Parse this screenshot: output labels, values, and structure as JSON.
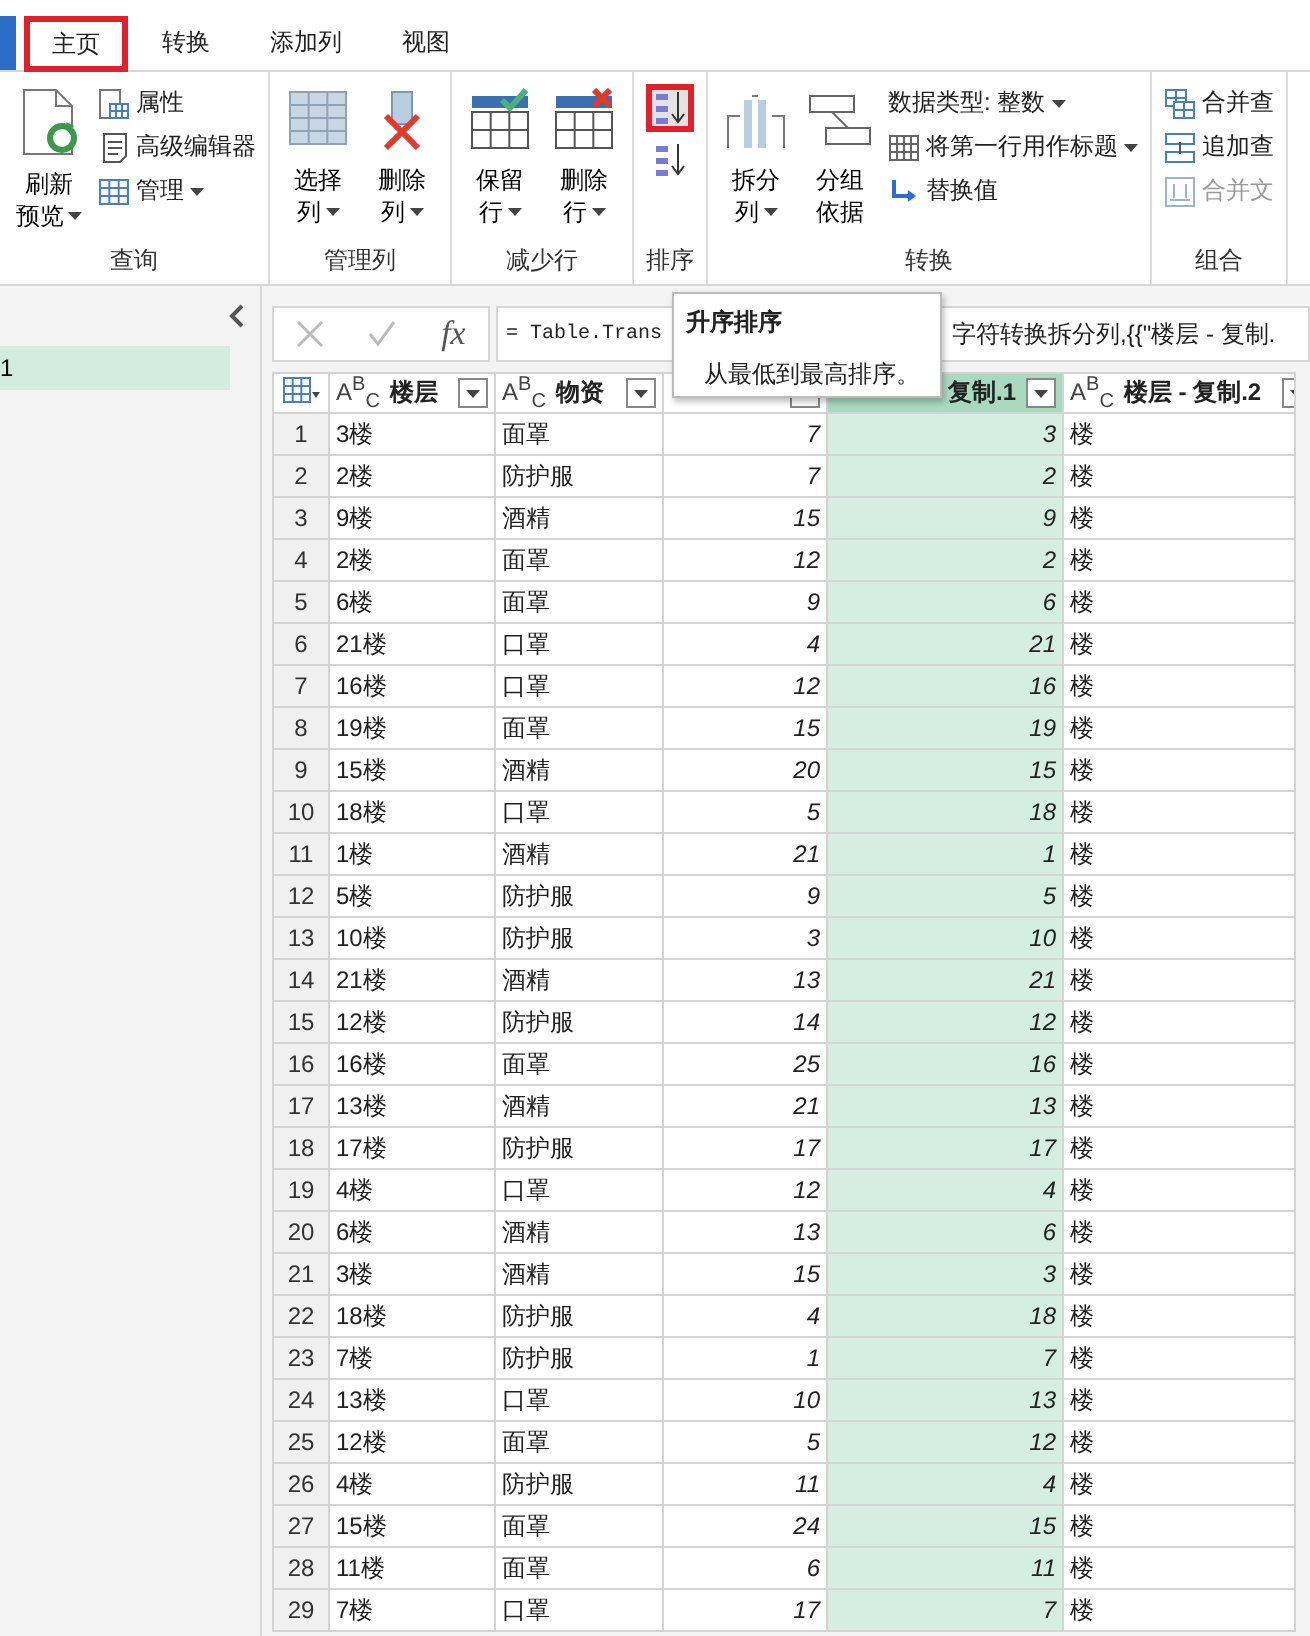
{
  "ribbon_tabs": [
    {
      "label": "主页",
      "selected": true,
      "annotated": true
    },
    {
      "label": "转换",
      "selected": false,
      "annotated": false
    },
    {
      "label": "添加列",
      "selected": false,
      "annotated": false
    },
    {
      "label": "视图",
      "selected": false,
      "annotated": false
    }
  ],
  "ribbon_groups": [
    {
      "label": "查询",
      "items": [
        {
          "kind": "large",
          "lines": [
            "刷新",
            "预览"
          ],
          "dropdown": true
        },
        {
          "kind": "stack",
          "items": [
            {
              "label": "属性",
              "dropdown": false,
              "disabled": false
            },
            {
              "label": "高级编辑器",
              "dropdown": false,
              "disabled": false
            },
            {
              "label": "管理",
              "dropdown": true,
              "disabled": false
            }
          ]
        }
      ]
    },
    {
      "label": "管理列",
      "items": [
        {
          "kind": "large",
          "lines": [
            "选择",
            "列"
          ],
          "dropdown": true
        },
        {
          "kind": "large",
          "lines": [
            "删除",
            "列"
          ],
          "dropdown": true
        }
      ]
    },
    {
      "label": "减少行",
      "items": [
        {
          "kind": "large",
          "lines": [
            "保留",
            "行"
          ],
          "dropdown": true
        },
        {
          "kind": "large",
          "lines": [
            "删除",
            "行"
          ],
          "dropdown": true
        }
      ]
    },
    {
      "label": "排序",
      "items": [
        {
          "kind": "sort",
          "buttons": [
            {
              "annotated": true
            },
            {
              "annotated": false
            }
          ]
        }
      ]
    },
    {
      "label": "转换",
      "items": [
        {
          "kind": "large",
          "lines": [
            "拆分",
            "列"
          ],
          "dropdown": true
        },
        {
          "kind": "large",
          "lines": [
            "分组",
            "依据"
          ],
          "dropdown": false
        },
        {
          "kind": "stack",
          "items": [
            {
              "label": "数据类型: 整数",
              "dropdown": true,
              "disabled": false
            },
            {
              "label": "将第一行用作标题",
              "dropdown": true,
              "disabled": false
            },
            {
              "label": "替换值",
              "dropdown": false,
              "disabled": false
            }
          ]
        }
      ]
    },
    {
      "label": "组合",
      "items": [
        {
          "kind": "stack",
          "items": [
            {
              "label": "合并查",
              "dropdown": false,
              "disabled": false
            },
            {
              "label": "追加查",
              "dropdown": false,
              "disabled": false
            },
            {
              "label": "合并文",
              "dropdown": false,
              "disabled": true
            }
          ]
        }
      ]
    }
  ],
  "queries": [
    {
      "name": "1",
      "selected": true
    }
  ],
  "formula_bar": {
    "fx": "fx",
    "parts": [
      "= Table.Trans",
      "字符转换拆分列,{{\"楼层 - 复制."
    ]
  },
  "tooltip": {
    "title": "升序排序",
    "text": "从最低到最高排序。"
  },
  "table": {
    "columns": [
      {
        "kind": "index",
        "selected": false
      },
      {
        "type_badge": "A$^{B}$$_{C}$",
        "name": "楼层",
        "kind": "text",
        "selected": false
      },
      {
        "type_badge": "A$^{B}$$_{C}$",
        "name": "物资",
        "kind": "text",
        "selected": false
      },
      {
        "kind": "number",
        "selected": false
      },
      {
        "name": "复制.1",
        "kind": "number",
        "selected": true
      },
      {
        "type_badge": "A$^{B}$$_{C}$",
        "name": "楼层 - 复制.2",
        "kind": "text",
        "selected": false
      }
    ],
    "rows": [
      [
        "1",
        "3楼",
        "面罩",
        "7",
        "3",
        "楼"
      ],
      [
        "2",
        "2楼",
        "防护服",
        "7",
        "2",
        "楼"
      ],
      [
        "3",
        "9楼",
        "酒精",
        "15",
        "9",
        "楼"
      ],
      [
        "4",
        "2楼",
        "面罩",
        "12",
        "2",
        "楼"
      ],
      [
        "5",
        "6楼",
        "面罩",
        "9",
        "6",
        "楼"
      ],
      [
        "6",
        "21楼",
        "口罩",
        "4",
        "21",
        "楼"
      ],
      [
        "7",
        "16楼",
        "口罩",
        "12",
        "16",
        "楼"
      ],
      [
        "8",
        "19楼",
        "面罩",
        "15",
        "19",
        "楼"
      ],
      [
        "9",
        "15楼",
        "酒精",
        "20",
        "15",
        "楼"
      ],
      [
        "10",
        "18楼",
        "口罩",
        "5",
        "18",
        "楼"
      ],
      [
        "11",
        "1楼",
        "酒精",
        "21",
        "1",
        "楼"
      ],
      [
        "12",
        "5楼",
        "防护服",
        "9",
        "5",
        "楼"
      ],
      [
        "13",
        "10楼",
        "防护服",
        "3",
        "10",
        "楼"
      ],
      [
        "14",
        "21楼",
        "酒精",
        "13",
        "21",
        "楼"
      ],
      [
        "15",
        "12楼",
        "防护服",
        "14",
        "12",
        "楼"
      ],
      [
        "16",
        "16楼",
        "面罩",
        "25",
        "16",
        "楼"
      ],
      [
        "17",
        "13楼",
        "酒精",
        "21",
        "13",
        "楼"
      ],
      [
        "18",
        "17楼",
        "防护服",
        "17",
        "17",
        "楼"
      ],
      [
        "19",
        "4楼",
        "口罩",
        "12",
        "4",
        "楼"
      ],
      [
        "20",
        "6楼",
        "酒精",
        "13",
        "6",
        "楼"
      ],
      [
        "21",
        "3楼",
        "酒精",
        "15",
        "3",
        "楼"
      ],
      [
        "22",
        "18楼",
        "防护服",
        "4",
        "18",
        "楼"
      ],
      [
        "23",
        "7楼",
        "防护服",
        "1",
        "7",
        "楼"
      ],
      [
        "24",
        "13楼",
        "口罩",
        "10",
        "13",
        "楼"
      ],
      [
        "25",
        "12楼",
        "面罩",
        "5",
        "12",
        "楼"
      ],
      [
        "26",
        "4楼",
        "防护服",
        "11",
        "4",
        "楼"
      ],
      [
        "27",
        "15楼",
        "面罩",
        "24",
        "15",
        "楼"
      ],
      [
        "28",
        "11楼",
        "面罩",
        "6",
        "11",
        "楼"
      ],
      [
        "29",
        "7楼",
        "口罩",
        "17",
        "7",
        "楼"
      ]
    ]
  }
}
